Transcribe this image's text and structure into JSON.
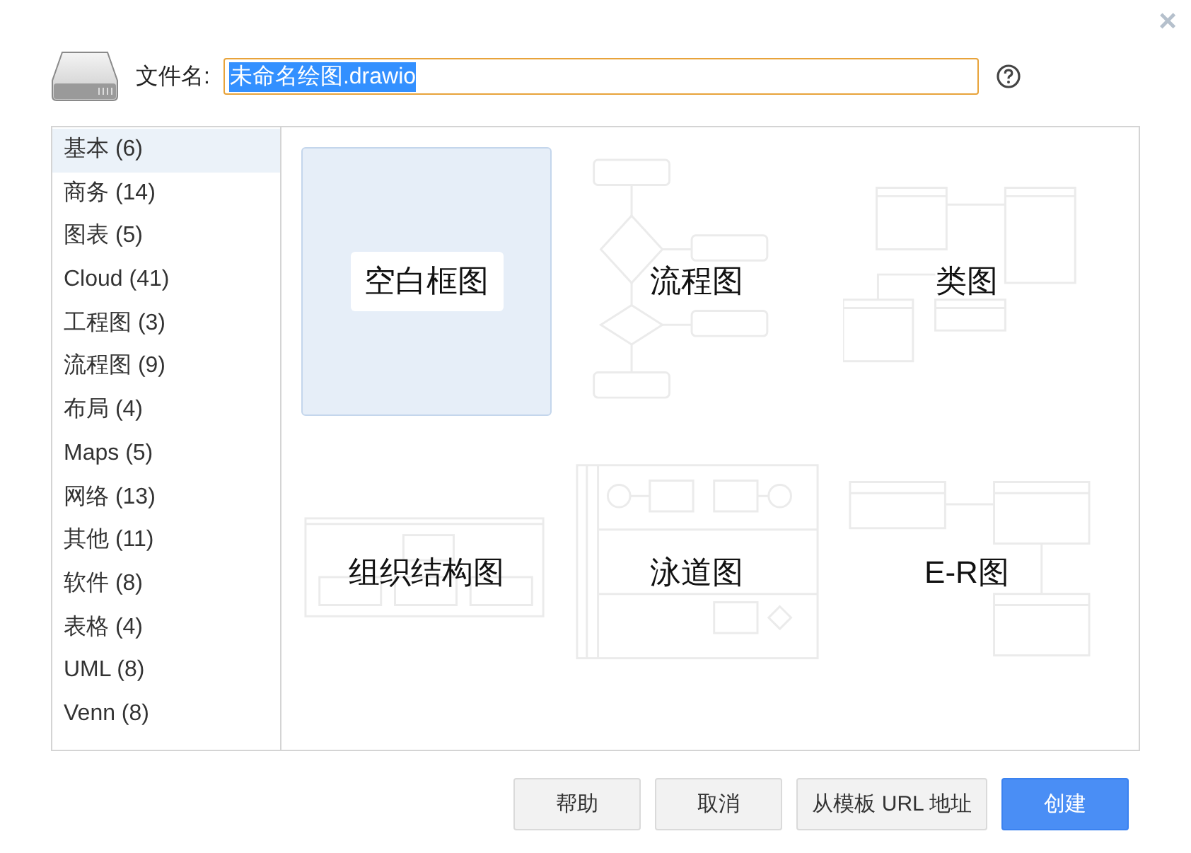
{
  "close": "×",
  "filename": {
    "label": "文件名:",
    "value": "未命名绘图.drawio",
    "text_selected": true
  },
  "categories": [
    {
      "label": "基本 (6)",
      "selected": true
    },
    {
      "label": "商务 (14)",
      "selected": false
    },
    {
      "label": "图表 (5)",
      "selected": false
    },
    {
      "label": "Cloud (41)",
      "selected": false
    },
    {
      "label": "工程图 (3)",
      "selected": false
    },
    {
      "label": "流程图 (9)",
      "selected": false
    },
    {
      "label": "布局 (4)",
      "selected": false
    },
    {
      "label": "Maps (5)",
      "selected": false
    },
    {
      "label": "网络 (13)",
      "selected": false
    },
    {
      "label": "其他 (11)",
      "selected": false
    },
    {
      "label": "软件 (8)",
      "selected": false
    },
    {
      "label": "表格 (4)",
      "selected": false
    },
    {
      "label": "UML (8)",
      "selected": false
    },
    {
      "label": "Venn (8)",
      "selected": false
    }
  ],
  "templates": [
    {
      "label": "空白框图",
      "kind": "blank",
      "selected": true
    },
    {
      "label": "流程图",
      "kind": "flowchart",
      "selected": false
    },
    {
      "label": "类图",
      "kind": "class",
      "selected": false
    },
    {
      "label": "组织结构图",
      "kind": "org",
      "selected": false
    },
    {
      "label": "泳道图",
      "kind": "swimlane",
      "selected": false
    },
    {
      "label": "E-R图",
      "kind": "er",
      "selected": false
    }
  ],
  "buttons": [
    {
      "label": "帮助",
      "primary": false
    },
    {
      "label": "取消",
      "primary": false
    },
    {
      "label": "从模板 URL 地址",
      "primary": false
    },
    {
      "label": "创建",
      "primary": true
    }
  ]
}
